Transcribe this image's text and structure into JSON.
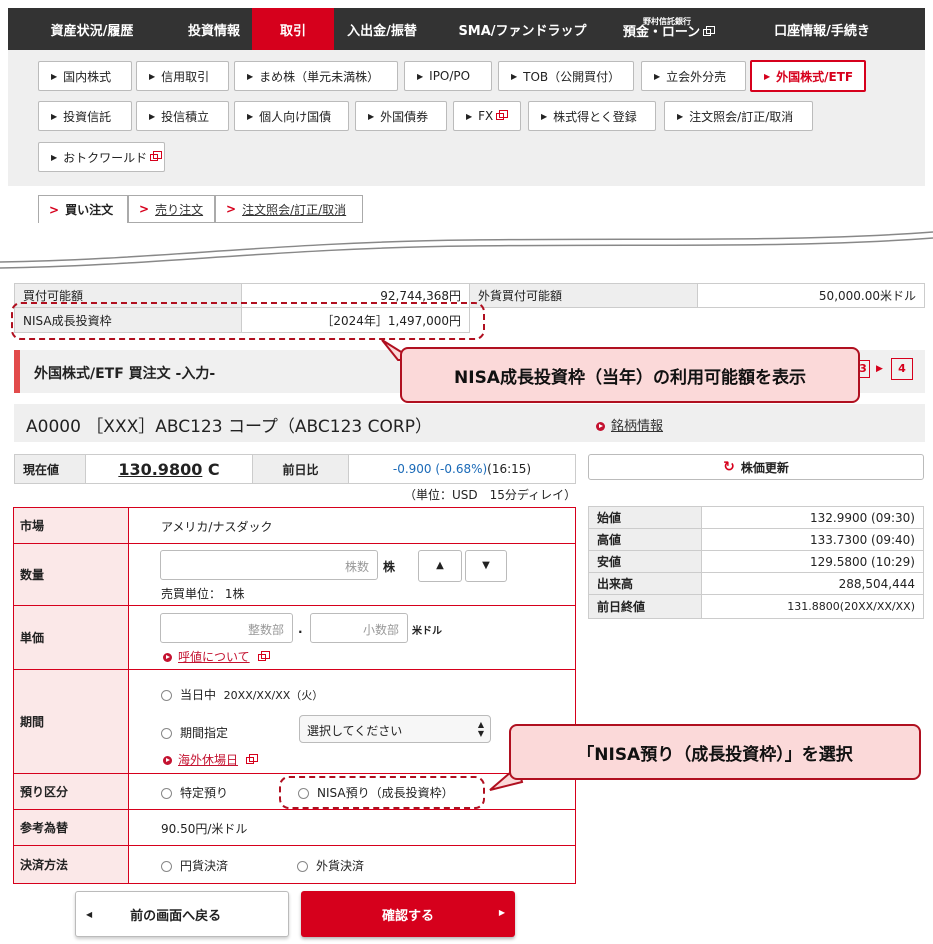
{
  "topnav": [
    {
      "label": "資産状況/履歴"
    },
    {
      "label": "投資情報"
    },
    {
      "label": "取引"
    },
    {
      "label": "入出金/振替"
    },
    {
      "label": "SMA/ファンドラップ"
    },
    {
      "label_small": "野村信託銀行",
      "label": "預金・ローン"
    },
    {
      "label": "口座情報/手続き"
    }
  ],
  "subnav": [
    "国内株式",
    "信用取引",
    "まめ株（単元未満株）",
    "IPO/PO",
    "TOB（公開買付）",
    "立会外分売",
    "外国株式/ETF",
    "投資信託",
    "投信積立",
    "個人向け国債",
    "外国債券",
    "FX",
    "株式得とく登録",
    "注文照会/訂正/取消",
    "おトクワールド"
  ],
  "order_tabs": [
    "買い注文",
    "売り注文",
    "注文照会/訂正/取消"
  ],
  "funds": {
    "buyable_label": "買付可能額",
    "buyable_value": "92,744,368円",
    "fx_label": "外貨買付可能額",
    "fx_value": "50,000.00米ドル",
    "nisa_label": "NISA成長投資枠",
    "nisa_value": "［2024年］1,497,000円"
  },
  "callout1": "NISA成長投資枠（当年）の利用可能額を表示",
  "callout2": "「NISA預り（成長投資枠）」を選択",
  "section_title": "外国株式/ETF 買注文 -入力-",
  "steps": [
    "3",
    "4"
  ],
  "stock": {
    "name": "A0000 ［XXX］ABC123 コープ（ABC123 CORP）",
    "info_link": "銘柄情報"
  },
  "price": {
    "current_label": "現在値",
    "current_value": "130.9800",
    "current_suffix": "C",
    "change_label": "前日比",
    "change_value": "-0.900 (-0.68%)",
    "change_time": " (16:15)",
    "unit_note": "（単位：USD　15分ディレイ）",
    "refresh": "株価更新"
  },
  "quotes": [
    {
      "label": "始値",
      "value": "132.9900 (09:30)"
    },
    {
      "label": "高値",
      "value": "133.7300 (09:40)"
    },
    {
      "label": "安値",
      "value": "129.5800 (10:29)"
    },
    {
      "label": "出来高",
      "value": "288,504,444"
    },
    {
      "label": "前日終値",
      "value": "131.8800(20XX/XX/XX)"
    }
  ],
  "form": {
    "market_label": "市場",
    "market_value": "アメリカ/ナスダック",
    "qty_label": "数量",
    "qty_placeholder": "株数",
    "qty_unit": "株",
    "qty_note": "売買単位： 1株",
    "price_label": "単価",
    "int_placeholder": "整数部",
    "dec_placeholder": "小数部",
    "price_unit": "米ドル",
    "tick_link": "呼値について",
    "period_label": "期間",
    "period_today": "当日中",
    "period_date": "20XX/XX/XX（火）",
    "period_specify": "期間指定",
    "period_select": "選択してください",
    "holiday_link": "海外休場日",
    "account_label": "預り区分",
    "account_tokutei": "特定預り",
    "account_nisa": "NISA預り（成長投資枠）",
    "rate_label": "参考為替",
    "rate_value": "90.50円/米ドル",
    "settle_label": "決済方法",
    "settle_yen": "円貨決済",
    "settle_fx": "外貨決済"
  },
  "buttons": {
    "back": "前の画面へ戻る",
    "confirm": "確認する"
  }
}
